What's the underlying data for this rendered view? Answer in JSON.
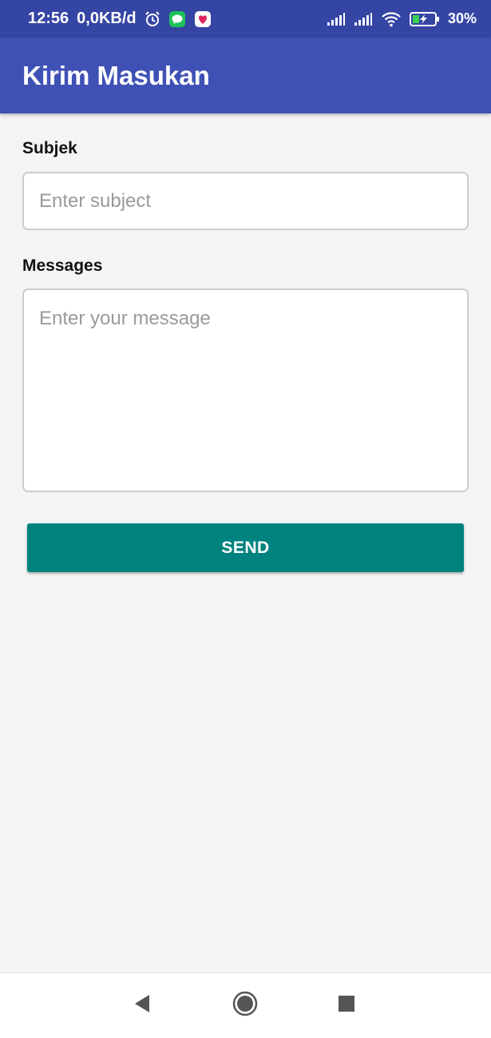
{
  "status_bar": {
    "time": "12:56",
    "data_rate": "0,0KB/d",
    "battery_percent": "30%",
    "icons": [
      "alarm-clock-icon",
      "chat-bubble-icon",
      "heart-app-icon",
      "signal-icon",
      "signal-icon",
      "wifi-icon",
      "battery-charging-icon"
    ]
  },
  "app_bar": {
    "title": "Kirim Masukan"
  },
  "form": {
    "subject_label": "Subjek",
    "subject_placeholder": "Enter subject",
    "subject_value": "",
    "message_label": "Messages",
    "message_placeholder": "Enter your message",
    "message_value": "",
    "send_label": "SEND"
  },
  "nav_bar": {
    "buttons": [
      "back-icon",
      "home-icon",
      "recents-icon"
    ]
  },
  "colors": {
    "status_bar": "#3545a3",
    "app_bar": "#3f51b5",
    "send_button": "#00837f",
    "background": "#f4f4f4"
  }
}
